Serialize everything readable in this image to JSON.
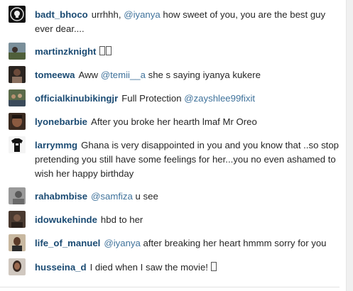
{
  "comments": [
    {
      "username": "badt_bhoco",
      "parts": [
        {
          "text": "urrhhh, "
        },
        {
          "mention": "@iyanya"
        },
        {
          "text": " how sweet of you, you are the best guy ever dear...."
        }
      ],
      "avatar": "skull-badge-avatar"
    },
    {
      "username": "martinzknight",
      "parts": [],
      "emoji_boxes": 2,
      "avatar": "landscape-avatar"
    },
    {
      "username": "tomeewa",
      "parts": [
        {
          "text": "Aww "
        },
        {
          "mention": "@temii__a"
        },
        {
          "text": " she s saying iyanya kukere"
        }
      ],
      "avatar": "portrait-avatar"
    },
    {
      "username": "officialkinubikingjr",
      "parts": [
        {
          "text": "Full Protection "
        },
        {
          "mention": "@zayshlee99fixit"
        }
      ],
      "avatar": "crowd-avatar"
    },
    {
      "username": "lyonebarbie",
      "parts": [
        {
          "text": "After you broke her hearth lmaf Mr Oreo"
        }
      ],
      "avatar": "face-avatar"
    },
    {
      "username": "larrymmg",
      "parts": [
        {
          "text": "Ghana is very disappointed in you and you know that ..so stop pretending you still have some feelings for her...you no even ashamed to wish her happy birthday"
        }
      ],
      "avatar": "tshirt-avatar"
    },
    {
      "username": "rahabmbise",
      "parts": [
        {
          "mention": "@samfiza"
        },
        {
          "text": " u see"
        }
      ],
      "avatar": "grey-portrait-avatar"
    },
    {
      "username": "idowukehinde",
      "parts": [
        {
          "text": "hbd to her"
        }
      ],
      "avatar": "dim-portrait-avatar"
    },
    {
      "username": "life_of_manuel",
      "parts": [
        {
          "mention": "@iyanya"
        },
        {
          "text": " after breaking her heart hmmm sorry for you"
        }
      ],
      "avatar": "man-avatar"
    },
    {
      "username": "husseina_d",
      "parts": [
        {
          "text": "I died when I saw the movie! "
        }
      ],
      "emoji_boxes": 1,
      "avatar": "woman-avatar"
    }
  ],
  "colors": {
    "username": "#1b4b73",
    "mention": "#3f729b",
    "text": "#262626"
  }
}
